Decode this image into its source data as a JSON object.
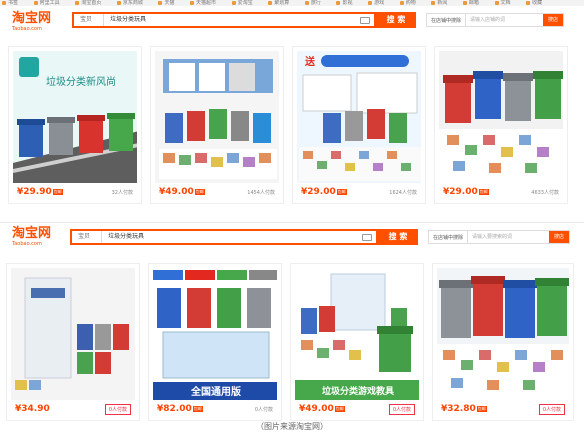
{
  "bookmarks": [
    "书签",
    "阿里工具",
    "淘宝首页",
    "京东商城",
    "天猫",
    "天猫超市",
    "爱淘宝",
    "聚划算",
    "旅行",
    "影视",
    "游戏",
    "购物",
    "新闻",
    "邮箱",
    "文档",
    "收藏"
  ],
  "screens": [
    {
      "logo_text": "淘宝网",
      "logo_sub": "Taobao.com",
      "search_scope": "宝贝",
      "search_query": "垃圾分类玩具",
      "search_button": "搜 索",
      "shop_label": "在店铺中搜除",
      "shop_placeholder": "请输入店铺的词",
      "shop_button": "搜店",
      "products": [
        {
          "price": "¥29.90",
          "tag": "包邮",
          "paid": "32人付款",
          "overlay": "垃圾分类新风尚"
        },
        {
          "price": "¥49.00",
          "tag": "包邮",
          "paid": "1454人付款",
          "overlay": ""
        },
        {
          "price": "¥29.00",
          "tag": "包邮",
          "paid": "1624人付款",
          "overlay": "送"
        },
        {
          "price": "¥29.00",
          "tag": "包邮",
          "paid": "4633人付款",
          "overlay": ""
        }
      ]
    },
    {
      "logo_text": "淘宝网",
      "logo_sub": "Taobao.com",
      "search_scope": "宝贝",
      "search_query": "垃圾分类玩具",
      "search_button": "搜 索",
      "shop_label": "在店铺中搜除",
      "shop_placeholder": "请输入要搜索的词",
      "shop_button": "搜店",
      "products": [
        {
          "price": "¥34.90",
          "tag": "",
          "paid": "0人付款",
          "overlay": ""
        },
        {
          "price": "¥82.00",
          "tag": "包邮",
          "paid": "0人付款",
          "overlay": "全国通用版"
        },
        {
          "price": "¥49.00",
          "tag": "包邮",
          "paid": "0人付款",
          "overlay": "垃圾分类游戏教具"
        },
        {
          "price": "¥32.80",
          "tag": "包邮",
          "paid": "0人付款",
          "overlay": ""
        }
      ]
    }
  ],
  "caption": "（图片来源淘宝网）"
}
